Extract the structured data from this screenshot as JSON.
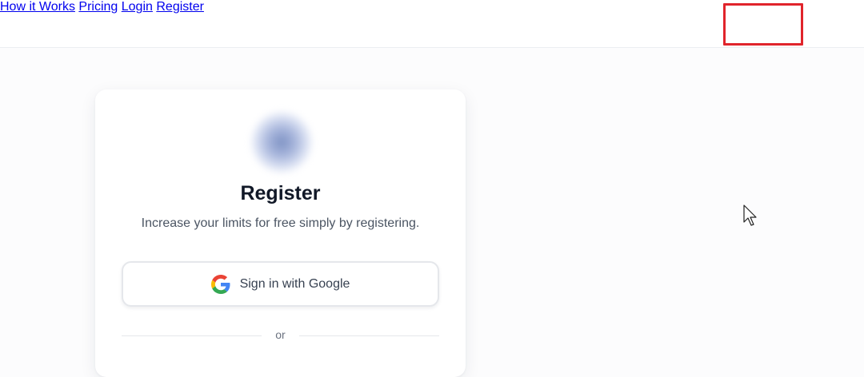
{
  "header": {
    "nav": [
      {
        "label": "How it Works"
      },
      {
        "label": "Pricing"
      },
      {
        "label": "Login"
      },
      {
        "label": "Register"
      }
    ]
  },
  "card": {
    "title": "Register",
    "subtitle": "Increase your limits for free simply by registering.",
    "google_button_label": "Sign in with Google",
    "divider_text": "or"
  },
  "icons": {
    "logo": "blurred-logo",
    "google": "google-icon",
    "cursor": "mouse-pointer-icon"
  },
  "colors": {
    "highlight": "#e0242b",
    "title": "#111827",
    "nav_text": "#4a5568"
  }
}
